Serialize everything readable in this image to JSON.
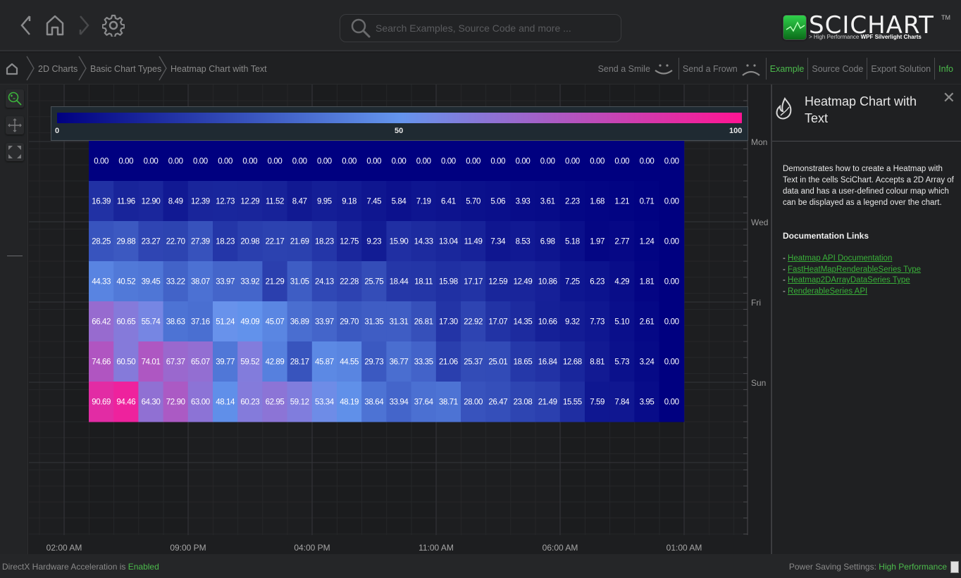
{
  "topbar": {
    "search_placeholder": "Search Examples, Source Code and more ...",
    "logo_title": "SCICHART",
    "logo_sub_prefix": "> High Performance ",
    "logo_sub_bold": "WPF Silverlight Charts",
    "logo_tm": "TM"
  },
  "breadcrumb": {
    "items": [
      "2D Charts",
      "Basic Chart Types",
      "Heatmap Chart with Text"
    ]
  },
  "actions": {
    "smile": "Send a Smile",
    "frown": "Send a Frown",
    "example": "Example",
    "source_code": "Source Code",
    "export": "Export Solution",
    "info": "Info"
  },
  "colors": {
    "accent_green": "#4cbb4c",
    "gradient_low": "#000080",
    "gradient_mid": "#6495ed",
    "gradient_high": "#ff1493"
  },
  "chart_data": {
    "type": "heatmap",
    "title": "Heatmap Chart with Text",
    "colormap": {
      "min": 0,
      "max": 100,
      "stops": [
        "#000080",
        "#6495ed",
        "#ff1493"
      ]
    },
    "legend": {
      "labels": [
        "0",
        "50",
        "100"
      ],
      "placement": "top"
    },
    "x_tick_labels": [
      "02:00 AM",
      "09:00 PM",
      "04:00 PM",
      "11:00 AM",
      "06:00 AM",
      "01:00 AM"
    ],
    "y_tick_labels": [
      "Mon",
      "Wed",
      "Fri",
      "Sun"
    ],
    "grid": true,
    "rows": [
      [
        "0.00",
        "0.00",
        "0.00",
        "0.00",
        "0.00",
        "0.00",
        "0.00",
        "0.00",
        "0.00",
        "0.00",
        "0.00",
        "0.00",
        "0.00",
        "0.00",
        "0.00",
        "0.00",
        "0.00",
        "0.00",
        "0.00",
        "0.00",
        "0.00",
        "0.00",
        "0.00",
        "0.00"
      ],
      [
        "16.39",
        "11.96",
        "12.90",
        "8.49",
        "12.39",
        "12.73",
        "12.29",
        "11.52",
        "8.47",
        "9.95",
        "9.18",
        "7.45",
        "5.84",
        "7.19",
        "6.41",
        "5.70",
        "5.06",
        "3.93",
        "3.61",
        "2.23",
        "1.68",
        "1.21",
        "0.71",
        "0.00"
      ],
      [
        "28.25",
        "29.88",
        "23.27",
        "22.70",
        "27.39",
        "18.23",
        "20.98",
        "22.17",
        "21.69",
        "18.23",
        "12.75",
        "9.23",
        "15.90",
        "14.33",
        "13.04",
        "11.49",
        "7.34",
        "8.53",
        "6.98",
        "5.18",
        "1.97",
        "2.77",
        "1.24",
        "0.00"
      ],
      [
        "44.33",
        "40.52",
        "39.45",
        "33.22",
        "38.07",
        "33.97",
        "33.92",
        "21.29",
        "31.05",
        "24.13",
        "22.28",
        "25.75",
        "18.44",
        "18.11",
        "15.98",
        "17.17",
        "12.59",
        "12.49",
        "10.86",
        "7.25",
        "6.23",
        "4.29",
        "1.81",
        "0.00"
      ],
      [
        "66.42",
        "60.65",
        "55.74",
        "38.63",
        "37.16",
        "51.24",
        "49.09",
        "45.07",
        "36.89",
        "33.97",
        "29.70",
        "31.35",
        "31.31",
        "26.81",
        "17.30",
        "22.92",
        "17.07",
        "14.35",
        "10.66",
        "9.32",
        "7.73",
        "5.10",
        "2.61",
        "0.00"
      ],
      [
        "74.66",
        "60.50",
        "74.01",
        "67.37",
        "65.07",
        "39.77",
        "59.52",
        "42.89",
        "28.17",
        "45.87",
        "44.55",
        "29.73",
        "36.77",
        "33.35",
        "21.06",
        "25.37",
        "25.01",
        "18.65",
        "16.84",
        "12.68",
        "8.81",
        "5.73",
        "3.24",
        "0.00"
      ],
      [
        "90.69",
        "94.46",
        "64.30",
        "72.90",
        "63.00",
        "48.14",
        "60.23",
        "62.95",
        "59.12",
        "53.34",
        "48.19",
        "38.64",
        "33.94",
        "37.64",
        "38.71",
        "28.00",
        "26.47",
        "23.08",
        "21.49",
        "15.55",
        "7.59",
        "7.84",
        "3.95",
        "0.00"
      ]
    ]
  },
  "panel": {
    "title": "Heatmap Chart with Text",
    "description": "Demonstrates how to create a Heatmap with Text in the cells SciChart. Accepts a 2D Array of data and has a user-defined colour map which can be displayed as a legend over the chart.",
    "links_heading": "Documentation Links",
    "links": [
      "Heatmap API Documentation",
      "FastHeatMapRenderableSeries Type",
      "Heatmap2DArrayDataSeries Type",
      "RenderableSeries API"
    ]
  },
  "status": {
    "dx_prefix": "DirectX Hardware Acceleration is ",
    "dx_value": "Enabled",
    "power_prefix": "Power Saving Settings: ",
    "power_value": "High Performance"
  }
}
